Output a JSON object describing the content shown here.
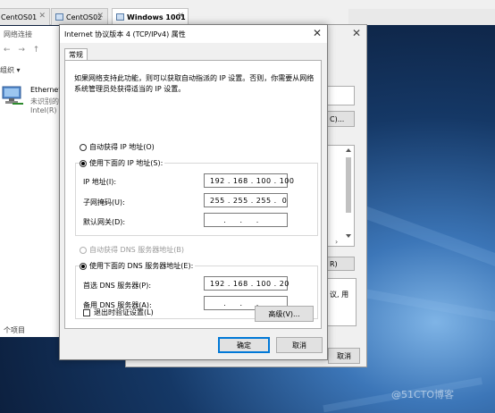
{
  "vm_tabs": [
    {
      "label": "CentOS01"
    },
    {
      "label": "CentOS02"
    },
    {
      "label": "Windows 1001"
    }
  ],
  "net_window": {
    "title": "网络连接",
    "nav": "← → ↑",
    "organize": "组织 ▾",
    "adapter_name": "Ethernet",
    "adapter_status": "未识别的",
    "adapter_device": "Intel(R) 8",
    "item_count": "个项目"
  },
  "eth_window": {
    "button1": "C)...",
    "button2": "R)",
    "text": "议, 用",
    "cancel": "取消"
  },
  "dialog": {
    "title": "Internet 协议版本 4 (TCP/IPv4) 属性",
    "tab": "常规",
    "description": "如果网络支持此功能，则可以获取自动指派的 IP 设置。否则，你需要从网络系统管理员处获得适当的 IP 设置。",
    "ip_auto": "自动获得 IP 地址(O)",
    "ip_manual": "使用下面的 IP 地址(S):",
    "ip_address_label": "IP 地址(I):",
    "ip_address": "192 . 168 . 100 . 100",
    "subnet_label": "子网掩码(U):",
    "subnet": "255 . 255 . 255 .  0",
    "gateway_label": "默认网关(D):",
    "gateway": "     .     .     .",
    "dns_auto": "自动获得 DNS 服务器地址(B)",
    "dns_manual": "使用下面的 DNS 服务器地址(E):",
    "dns_primary_label": "首选 DNS 服务器(P):",
    "dns_primary": "192 . 168 . 100 . 20",
    "dns_alt_label": "备用 DNS 服务器(A):",
    "dns_alt": "     .     .     .",
    "validate_label": "退出时验证设置(L)",
    "advanced": "高级(V)...",
    "ok": "确定",
    "cancel": "取消"
  },
  "watermark": "@51CTO博客"
}
